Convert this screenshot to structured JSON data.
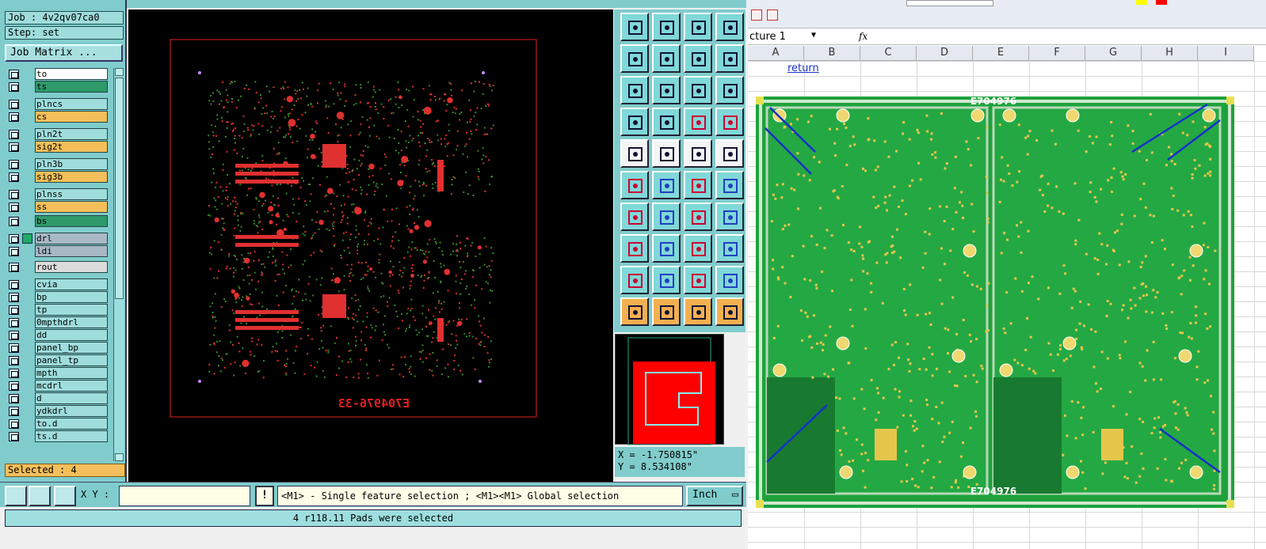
{
  "left_panel": {
    "job": "Job : 4v2qv07ca0",
    "step": "Step: set",
    "matrix_button": "Job Matrix ...",
    "layers": [
      {
        "name": "to",
        "color": "#ffffff"
      },
      {
        "name": "ts",
        "color": "#2e9a6a"
      },
      {
        "name": "plncs",
        "color": "#9fdcdc"
      },
      {
        "name": "cs",
        "color": "#f4bf5a"
      },
      {
        "name": "pln2t",
        "color": "#9fdcdc"
      },
      {
        "name": "sig2t",
        "color": "#f4bf5a"
      },
      {
        "name": "pln3b",
        "color": "#9fdcdc"
      },
      {
        "name": "sig3b",
        "color": "#f4bf5a"
      },
      {
        "name": "plnss",
        "color": "#9fdcdc"
      },
      {
        "name": "ss",
        "color": "#f4bf5a"
      },
      {
        "name": "bs",
        "color": "#2e9a6a"
      },
      {
        "name": "drl",
        "color": "#a8b8c4"
      },
      {
        "name": "ldi",
        "color": "#a8b8c4"
      },
      {
        "name": "rout",
        "color": "#dcdcdc"
      },
      {
        "name": "cvia",
        "color": "#9fdcdc"
      },
      {
        "name": "bp",
        "color": "#9fdcdc"
      },
      {
        "name": "tp",
        "color": "#9fdcdc"
      },
      {
        "name": "0mpthdrl",
        "color": "#9fdcdc"
      },
      {
        "name": "dd",
        "color": "#9fdcdc"
      },
      {
        "name": "panel_bp",
        "color": "#9fdcdc"
      },
      {
        "name": "panel_tp",
        "color": "#9fdcdc"
      },
      {
        "name": "mpth",
        "color": "#9fdcdc"
      },
      {
        "name": "mcdrl",
        "color": "#9fdcdc"
      },
      {
        "name": "d",
        "color": "#9fdcdc"
      },
      {
        "name": "ydkdrl",
        "color": "#9fdcdc"
      },
      {
        "name": "to.d",
        "color": "#9fdcdc"
      },
      {
        "name": "ts.d",
        "color": "#9fdcdc"
      }
    ],
    "selected": "Selected : 4"
  },
  "canvas": {
    "board_label": "E704976-33"
  },
  "coords": {
    "x": "X = -1.750815\"",
    "y": "Y = 8.534108\""
  },
  "bottom": {
    "xy_label": "X Y :",
    "xy_value": "",
    "hint": "<M1> - Single feature selection ; <M1><M1> Global selection",
    "units": "Inch",
    "status": "4 r118.11 Pads were selected"
  },
  "excel": {
    "name_box": "cture 1",
    "fx": "fx",
    "columns": [
      "A",
      "B",
      "C",
      "D",
      "E",
      "F",
      "G",
      "H",
      "I"
    ],
    "return_link": "return",
    "pcb_label_top": "E704976",
    "pcb_label_bottom": "E704976"
  },
  "colors": {
    "teal": "#80cccc",
    "pcb_green": "#1ea23c",
    "pad_gold": "#e6c64a"
  }
}
